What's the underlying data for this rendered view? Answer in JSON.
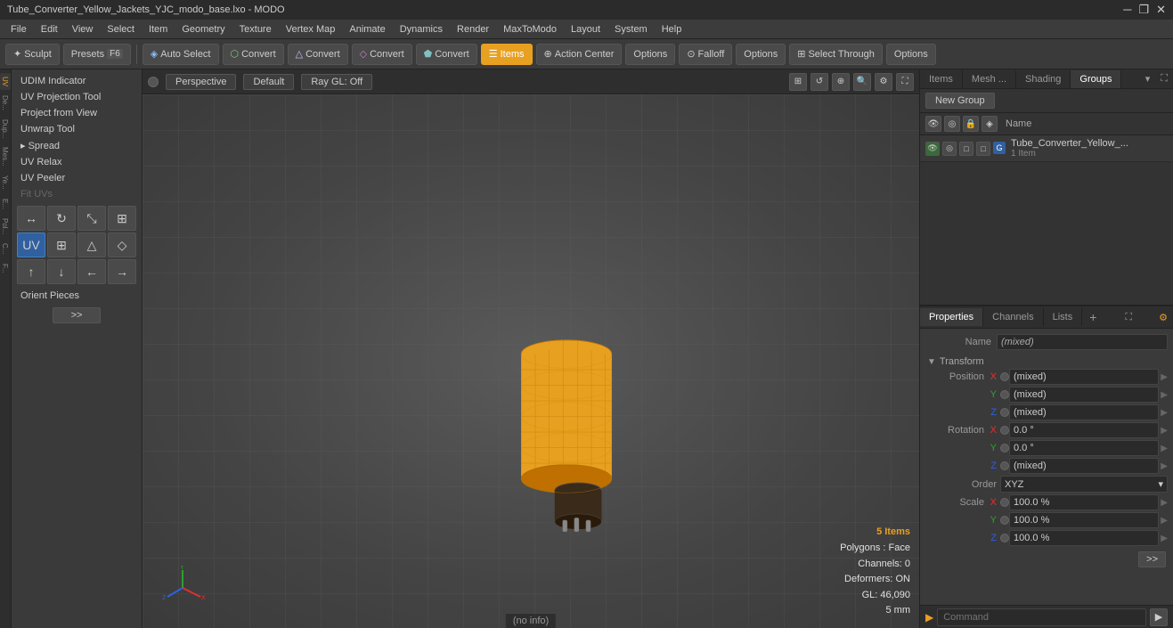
{
  "titlebar": {
    "title": "Tube_Converter_Yellow_Jackets_YJC_modo_base.lxo - MODO",
    "controls": [
      "─",
      "❐",
      "✕"
    ]
  },
  "menubar": {
    "items": [
      "File",
      "Edit",
      "View",
      "Select",
      "Item",
      "Geometry",
      "Texture",
      "Vertex Map",
      "Animate",
      "Dynamics",
      "Render",
      "MaxToModo",
      "Layout",
      "System",
      "Help"
    ]
  },
  "toolbar": {
    "sculpt_label": "Sculpt",
    "presets_label": "Presets",
    "presets_shortcut": "F6",
    "auto_select_label": "Auto Select",
    "convert1_label": "Convert",
    "convert2_label": "Convert",
    "convert3_label": "Convert",
    "convert4_label": "Convert",
    "items_label": "Items",
    "action_center_label": "Action Center",
    "options1_label": "Options",
    "falloff_label": "Falloff",
    "options2_label": "Options",
    "select_through_label": "Select Through",
    "options3_label": "Options"
  },
  "left_panel": {
    "tools": [
      {
        "label": "UDIM Indicator",
        "disabled": false
      },
      {
        "label": "UV Projection Tool",
        "disabled": false
      },
      {
        "label": "Project from View",
        "disabled": false
      },
      {
        "label": "Unwrap Tool",
        "disabled": false
      },
      {
        "label": "▸ Spread",
        "disabled": false
      },
      {
        "label": "UV Relax",
        "disabled": false
      },
      {
        "label": "UV Peeler",
        "disabled": false
      },
      {
        "label": "Fit UVs",
        "disabled": true
      },
      {
        "label": "Orient Pieces",
        "disabled": false
      }
    ]
  },
  "viewport": {
    "tab_perspective": "Perspective",
    "tab_default": "Default",
    "tab_raygl": "Ray GL: Off",
    "info": {
      "items_count": "5 Items",
      "polygons": "Polygons : Face",
      "channels": "Channels: 0",
      "deformers": "Deformers: ON",
      "gl": "GL: 46,090",
      "size": "5 mm"
    },
    "status": "(no info)"
  },
  "right_panel": {
    "tabs": [
      "Items",
      "Mesh ...",
      "Shading",
      "Groups"
    ],
    "active_tab": "Groups",
    "new_group_label": "New Group",
    "group_header_label": "Name",
    "group_items": [
      {
        "name": "Tube_Converter_Yellow_...",
        "count": "1 Item"
      }
    ]
  },
  "properties": {
    "tabs": [
      "Properties",
      "Channels",
      "Lists"
    ],
    "add_label": "+",
    "name_label": "Name",
    "name_value": "(mixed)",
    "transform_label": "Transform",
    "position": {
      "label": "Position",
      "x_value": "(mixed)",
      "y_value": "(mixed)",
      "z_value": "(mixed)"
    },
    "rotation": {
      "label": "Rotation",
      "x_value": "0.0 °",
      "y_value": "0.0 °",
      "z_value": "(mixed)"
    },
    "order_label": "Order",
    "order_value": "XYZ",
    "scale": {
      "label": "Scale",
      "x_value": "100.0 %",
      "y_value": "100.0 %",
      "z_value": "100.0 %"
    }
  },
  "command_bar": {
    "placeholder": "Command"
  }
}
